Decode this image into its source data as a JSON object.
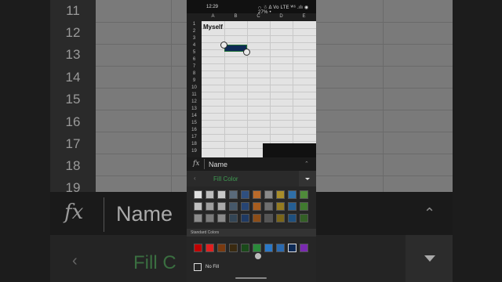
{
  "status_bar": {
    "time": "12:29",
    "icons_text": "∩ ☃ Δ Vo LTE ᵂ⁶ .ılı ◉ 27% •",
    "battery": "27%"
  },
  "sheet": {
    "columns": [
      "A",
      "B",
      "C",
      "D",
      "E"
    ],
    "rows": [
      "1",
      "2",
      "3",
      "4",
      "5",
      "6",
      "7",
      "8",
      "9",
      "10",
      "11",
      "12",
      "13",
      "14",
      "15",
      "16",
      "17",
      "18",
      "19"
    ],
    "cell_a1": "Myself",
    "selected_fill_color": "#0e2a55"
  },
  "formula_bar": {
    "fx_label": "fx",
    "value": "Name"
  },
  "fill_panel": {
    "title": "Fill Color",
    "standard_colors_label": "Standard Colors",
    "no_fill_label": "No Fill",
    "theme_rows": [
      [
        "#e0e0e0",
        "#bdbdbd",
        "#c8c8c8",
        "#5a6a7a",
        "#2f4f7f",
        "#b96a2a",
        "#8a8a8a",
        "#a88d2a",
        "#2f6fa8",
        "#4f8a3a"
      ],
      [
        "#bfbfbf",
        "#9e9e9e",
        "#aaaaaa",
        "#46586a",
        "#274574",
        "#a85d1f",
        "#6f6f6f",
        "#947b20",
        "#255f94",
        "#407a2f"
      ],
      [
        "#8c8c8c",
        "#7a7a7a",
        "#8a8a8a",
        "#334555",
        "#1f3a63",
        "#8c4d18",
        "#555555",
        "#7a6519",
        "#1e4f7d",
        "#335f26"
      ]
    ],
    "standard_colors": [
      "#c00000",
      "#e02020",
      "#7a3a10",
      "#3a2a10",
      "#1a4a1a",
      "#2a8a3a",
      "#2a78c8",
      "#2a6ab0",
      "#0e2a55",
      "#7a2ab0"
    ]
  },
  "background_copy": {
    "rows": [
      "11",
      "12",
      "13",
      "14",
      "15",
      "16",
      "17",
      "18",
      "19"
    ],
    "fx_label": "fx",
    "name": "Name",
    "fill_title": "Fill C"
  }
}
